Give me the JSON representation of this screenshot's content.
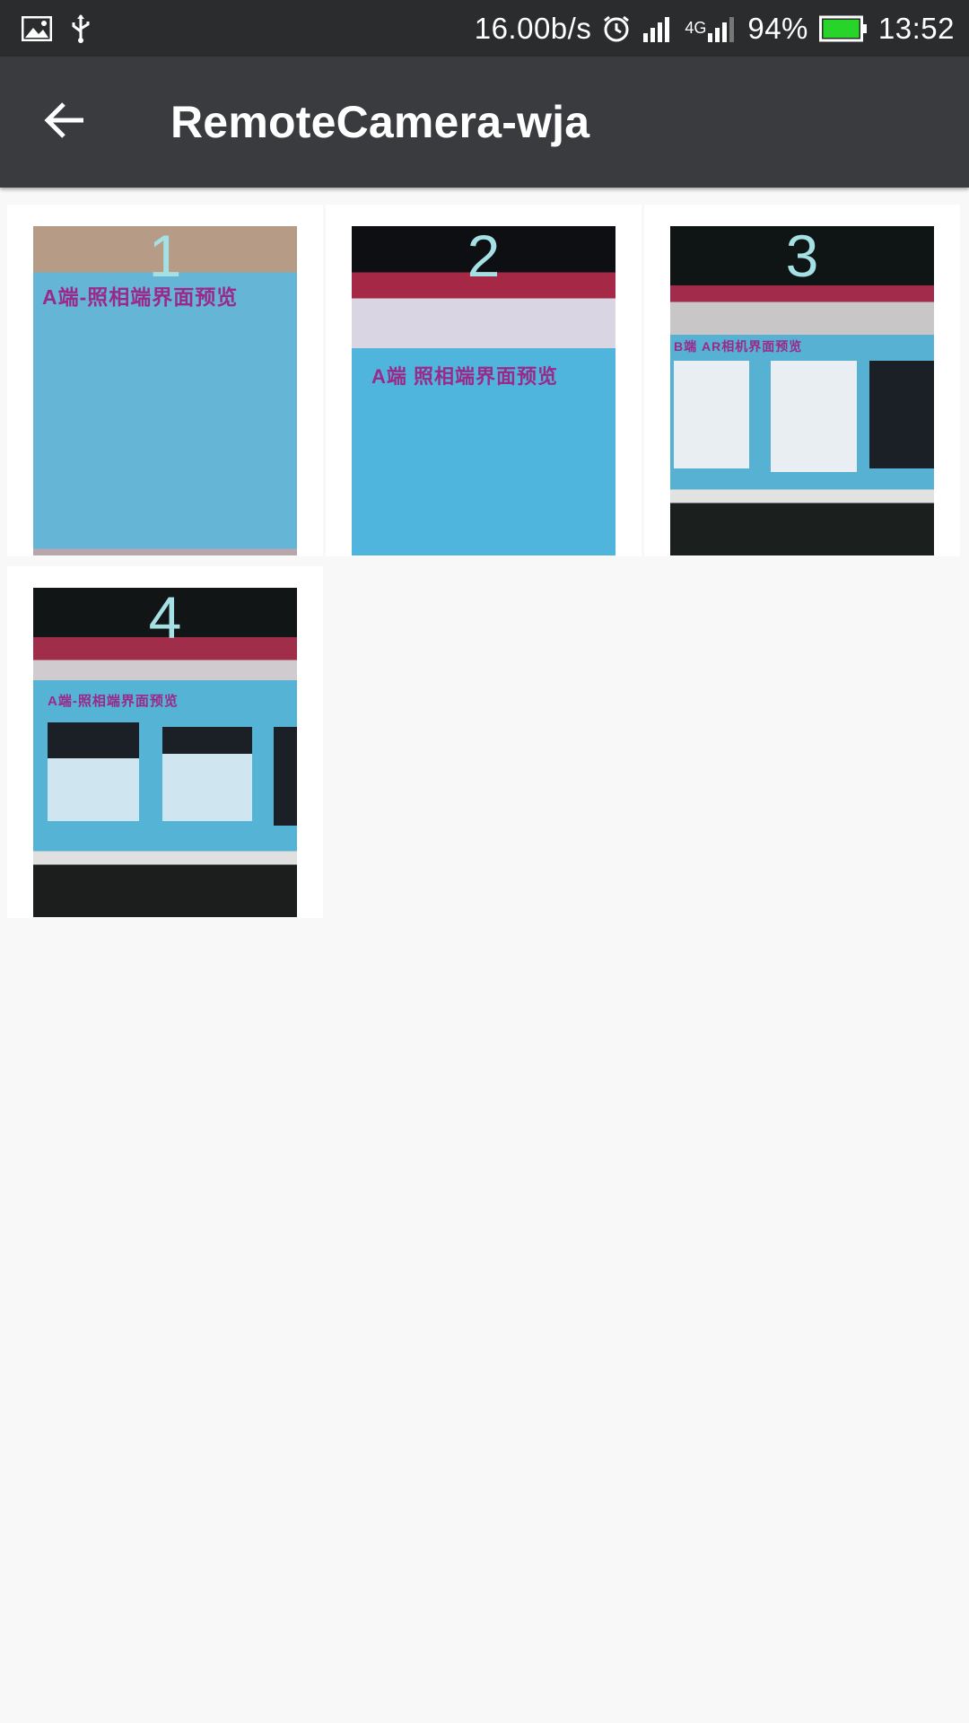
{
  "status_bar": {
    "net_speed": "16.00b/s",
    "network_type": "4G",
    "battery_percent": "94%",
    "time": "13:52",
    "battery_color": "#28d32a",
    "icons": [
      "image-icon",
      "usb-icon",
      "alarm-icon",
      "signal-icon",
      "signal-4g-icon",
      "battery-icon"
    ]
  },
  "app_bar": {
    "title": "RemoteCamera-wja",
    "back_icon": "arrow-left-icon"
  },
  "gallery": {
    "items": [
      {
        "number": "1",
        "caption": "A端-照相端界面预览"
      },
      {
        "number": "2",
        "caption": "A端 照相端界面预览"
      },
      {
        "number": "3",
        "caption": "B端 AR相机界面预览"
      },
      {
        "number": "4",
        "caption": "A端-照相端界面预览"
      }
    ]
  }
}
